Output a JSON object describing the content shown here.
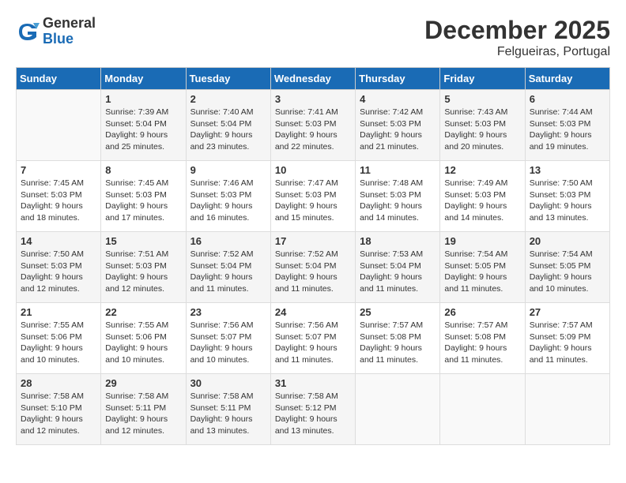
{
  "header": {
    "logo": {
      "general": "General",
      "blue": "Blue"
    },
    "title": "December 2025",
    "location": "Felgueiras, Portugal"
  },
  "calendar": {
    "weekdays": [
      "Sunday",
      "Monday",
      "Tuesday",
      "Wednesday",
      "Thursday",
      "Friday",
      "Saturday"
    ],
    "weeks": [
      [
        {
          "day": "",
          "info": ""
        },
        {
          "day": "1",
          "info": "Sunrise: 7:39 AM\nSunset: 5:04 PM\nDaylight: 9 hours\nand 25 minutes."
        },
        {
          "day": "2",
          "info": "Sunrise: 7:40 AM\nSunset: 5:04 PM\nDaylight: 9 hours\nand 23 minutes."
        },
        {
          "day": "3",
          "info": "Sunrise: 7:41 AM\nSunset: 5:03 PM\nDaylight: 9 hours\nand 22 minutes."
        },
        {
          "day": "4",
          "info": "Sunrise: 7:42 AM\nSunset: 5:03 PM\nDaylight: 9 hours\nand 21 minutes."
        },
        {
          "day": "5",
          "info": "Sunrise: 7:43 AM\nSunset: 5:03 PM\nDaylight: 9 hours\nand 20 minutes."
        },
        {
          "day": "6",
          "info": "Sunrise: 7:44 AM\nSunset: 5:03 PM\nDaylight: 9 hours\nand 19 minutes."
        }
      ],
      [
        {
          "day": "7",
          "info": "Sunrise: 7:45 AM\nSunset: 5:03 PM\nDaylight: 9 hours\nand 18 minutes."
        },
        {
          "day": "8",
          "info": "Sunrise: 7:45 AM\nSunset: 5:03 PM\nDaylight: 9 hours\nand 17 minutes."
        },
        {
          "day": "9",
          "info": "Sunrise: 7:46 AM\nSunset: 5:03 PM\nDaylight: 9 hours\nand 16 minutes."
        },
        {
          "day": "10",
          "info": "Sunrise: 7:47 AM\nSunset: 5:03 PM\nDaylight: 9 hours\nand 15 minutes."
        },
        {
          "day": "11",
          "info": "Sunrise: 7:48 AM\nSunset: 5:03 PM\nDaylight: 9 hours\nand 14 minutes."
        },
        {
          "day": "12",
          "info": "Sunrise: 7:49 AM\nSunset: 5:03 PM\nDaylight: 9 hours\nand 14 minutes."
        },
        {
          "day": "13",
          "info": "Sunrise: 7:50 AM\nSunset: 5:03 PM\nDaylight: 9 hours\nand 13 minutes."
        }
      ],
      [
        {
          "day": "14",
          "info": "Sunrise: 7:50 AM\nSunset: 5:03 PM\nDaylight: 9 hours\nand 12 minutes."
        },
        {
          "day": "15",
          "info": "Sunrise: 7:51 AM\nSunset: 5:03 PM\nDaylight: 9 hours\nand 12 minutes."
        },
        {
          "day": "16",
          "info": "Sunrise: 7:52 AM\nSunset: 5:04 PM\nDaylight: 9 hours\nand 11 minutes."
        },
        {
          "day": "17",
          "info": "Sunrise: 7:52 AM\nSunset: 5:04 PM\nDaylight: 9 hours\nand 11 minutes."
        },
        {
          "day": "18",
          "info": "Sunrise: 7:53 AM\nSunset: 5:04 PM\nDaylight: 9 hours\nand 11 minutes."
        },
        {
          "day": "19",
          "info": "Sunrise: 7:54 AM\nSunset: 5:05 PM\nDaylight: 9 hours\nand 11 minutes."
        },
        {
          "day": "20",
          "info": "Sunrise: 7:54 AM\nSunset: 5:05 PM\nDaylight: 9 hours\nand 10 minutes."
        }
      ],
      [
        {
          "day": "21",
          "info": "Sunrise: 7:55 AM\nSunset: 5:06 PM\nDaylight: 9 hours\nand 10 minutes."
        },
        {
          "day": "22",
          "info": "Sunrise: 7:55 AM\nSunset: 5:06 PM\nDaylight: 9 hours\nand 10 minutes."
        },
        {
          "day": "23",
          "info": "Sunrise: 7:56 AM\nSunset: 5:07 PM\nDaylight: 9 hours\nand 10 minutes."
        },
        {
          "day": "24",
          "info": "Sunrise: 7:56 AM\nSunset: 5:07 PM\nDaylight: 9 hours\nand 11 minutes."
        },
        {
          "day": "25",
          "info": "Sunrise: 7:57 AM\nSunset: 5:08 PM\nDaylight: 9 hours\nand 11 minutes."
        },
        {
          "day": "26",
          "info": "Sunrise: 7:57 AM\nSunset: 5:08 PM\nDaylight: 9 hours\nand 11 minutes."
        },
        {
          "day": "27",
          "info": "Sunrise: 7:57 AM\nSunset: 5:09 PM\nDaylight: 9 hours\nand 11 minutes."
        }
      ],
      [
        {
          "day": "28",
          "info": "Sunrise: 7:58 AM\nSunset: 5:10 PM\nDaylight: 9 hours\nand 12 minutes."
        },
        {
          "day": "29",
          "info": "Sunrise: 7:58 AM\nSunset: 5:11 PM\nDaylight: 9 hours\nand 12 minutes."
        },
        {
          "day": "30",
          "info": "Sunrise: 7:58 AM\nSunset: 5:11 PM\nDaylight: 9 hours\nand 13 minutes."
        },
        {
          "day": "31",
          "info": "Sunrise: 7:58 AM\nSunset: 5:12 PM\nDaylight: 9 hours\nand 13 minutes."
        },
        {
          "day": "",
          "info": ""
        },
        {
          "day": "",
          "info": ""
        },
        {
          "day": "",
          "info": ""
        }
      ]
    ]
  }
}
